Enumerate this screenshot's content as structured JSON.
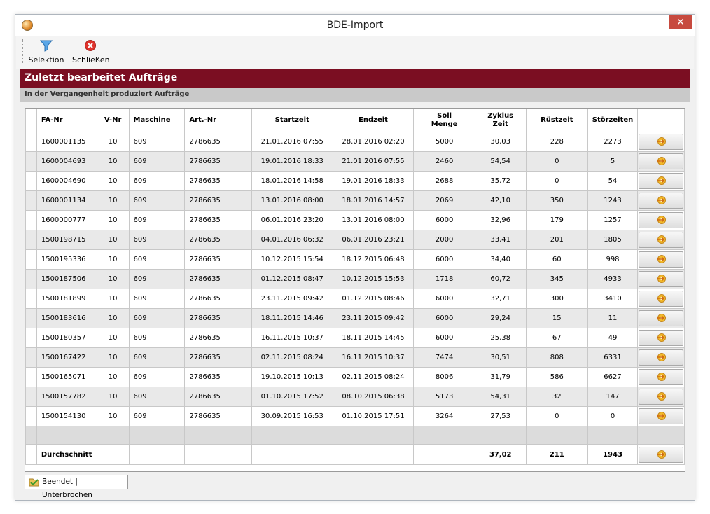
{
  "window": {
    "title": "BDE-Import",
    "close_glyph": "✕"
  },
  "toolbar": {
    "selektion_label": "Selektion",
    "selektion_icon": "filter-icon",
    "schliessen_label": "Schließen",
    "schliessen_icon": "close-circle-icon"
  },
  "banner": {
    "title": "Zuletzt bearbeitet Aufträge",
    "subtitle": "In der Vergangenheit produziert Aufträge"
  },
  "colors": {
    "banner_bg": "#7b0e22",
    "subbanner_bg": "#c9c9c9",
    "close_button": "#c74a3f",
    "alt_row": "#e9e9e9"
  },
  "table": {
    "headers": {
      "fa_nr": "FA-Nr",
      "v_nr": "V-Nr",
      "maschine": "Maschine",
      "art_nr": "Art.-Nr",
      "startzeit": "Startzeit",
      "endzeit": "Endzeit",
      "soll_menge_1": "Soll",
      "soll_menge_2": "Menge",
      "zyklus_zeit_1": "Zyklus",
      "zyklus_zeit_2": "Zeit",
      "ruestzeit": "Rüstzeit",
      "stoerzeiten": "Störzeiten"
    },
    "rows": [
      {
        "fa": "1600001135",
        "v": "10",
        "m": "609",
        "art": "2786635",
        "start": "21.01.2016 07:55",
        "end": "28.01.2016 02:20",
        "soll": "5000",
        "zyklus": "30,03",
        "ruest": "228",
        "stoer": "2273"
      },
      {
        "fa": "1600004693",
        "v": "10",
        "m": "609",
        "art": "2786635",
        "start": "19.01.2016 18:33",
        "end": "21.01.2016 07:55",
        "soll": "2460",
        "zyklus": "54,54",
        "ruest": "0",
        "stoer": "5"
      },
      {
        "fa": "1600004690",
        "v": "10",
        "m": "609",
        "art": "2786635",
        "start": "18.01.2016 14:58",
        "end": "19.01.2016 18:33",
        "soll": "2688",
        "zyklus": "35,72",
        "ruest": "0",
        "stoer": "54"
      },
      {
        "fa": "1600001134",
        "v": "10",
        "m": "609",
        "art": "2786635",
        "start": "13.01.2016 08:00",
        "end": "18.01.2016 14:57",
        "soll": "2069",
        "zyklus": "42,10",
        "ruest": "350",
        "stoer": "1243"
      },
      {
        "fa": "1600000777",
        "v": "10",
        "m": "609",
        "art": "2786635",
        "start": "06.01.2016 23:20",
        "end": "13.01.2016 08:00",
        "soll": "6000",
        "zyklus": "32,96",
        "ruest": "179",
        "stoer": "1257"
      },
      {
        "fa": "1500198715",
        "v": "10",
        "m": "609",
        "art": "2786635",
        "start": "04.01.2016 06:32",
        "end": "06.01.2016 23:21",
        "soll": "2000",
        "zyklus": "33,41",
        "ruest": "201",
        "stoer": "1805"
      },
      {
        "fa": "1500195336",
        "v": "10",
        "m": "609",
        "art": "2786635",
        "start": "10.12.2015 15:54",
        "end": "18.12.2015 06:48",
        "soll": "6000",
        "zyklus": "34,40",
        "ruest": "60",
        "stoer": "998"
      },
      {
        "fa": "1500187506",
        "v": "10",
        "m": "609",
        "art": "2786635",
        "start": "01.12.2015 08:47",
        "end": "10.12.2015 15:53",
        "soll": "1718",
        "zyklus": "60,72",
        "ruest": "345",
        "stoer": "4933"
      },
      {
        "fa": "1500181899",
        "v": "10",
        "m": "609",
        "art": "2786635",
        "start": "23.11.2015 09:42",
        "end": "01.12.2015 08:46",
        "soll": "6000",
        "zyklus": "32,71",
        "ruest": "300",
        "stoer": "3410"
      },
      {
        "fa": "1500183616",
        "v": "10",
        "m": "609",
        "art": "2786635",
        "start": "18.11.2015 14:46",
        "end": "23.11.2015 09:42",
        "soll": "6000",
        "zyklus": "29,24",
        "ruest": "15",
        "stoer": "11"
      },
      {
        "fa": "1500180357",
        "v": "10",
        "m": "609",
        "art": "2786635",
        "start": "16.11.2015 10:37",
        "end": "18.11.2015 14:45",
        "soll": "6000",
        "zyklus": "25,38",
        "ruest": "67",
        "stoer": "49"
      },
      {
        "fa": "1500167422",
        "v": "10",
        "m": "609",
        "art": "2786635",
        "start": "02.11.2015 08:24",
        "end": "16.11.2015 10:37",
        "soll": "7474",
        "zyklus": "30,51",
        "ruest": "808",
        "stoer": "6331"
      },
      {
        "fa": "1500165071",
        "v": "10",
        "m": "609",
        "art": "2786635",
        "start": "19.10.2015 10:13",
        "end": "02.11.2015 08:24",
        "soll": "8006",
        "zyklus": "31,79",
        "ruest": "586",
        "stoer": "6627"
      },
      {
        "fa": "1500157782",
        "v": "10",
        "m": "609",
        "art": "2786635",
        "start": "01.10.2015 17:52",
        "end": "08.10.2015 06:38",
        "soll": "5173",
        "zyklus": "54,31",
        "ruest": "32",
        "stoer": "147"
      },
      {
        "fa": "1500154130",
        "v": "10",
        "m": "609",
        "art": "2786635",
        "start": "30.09.2015 16:53",
        "end": "01.10.2015 17:51",
        "soll": "3264",
        "zyklus": "27,53",
        "ruest": "0",
        "stoer": "0"
      }
    ],
    "average": {
      "label": "Durchschnitt",
      "zyklus": "37,02",
      "ruest": "211",
      "stoer": "1943"
    },
    "row_button_icon": "gear-arrow-icon"
  },
  "tabs": {
    "active_label": "Beendet | Unterbrochen",
    "active_icon": "folder-icon"
  }
}
